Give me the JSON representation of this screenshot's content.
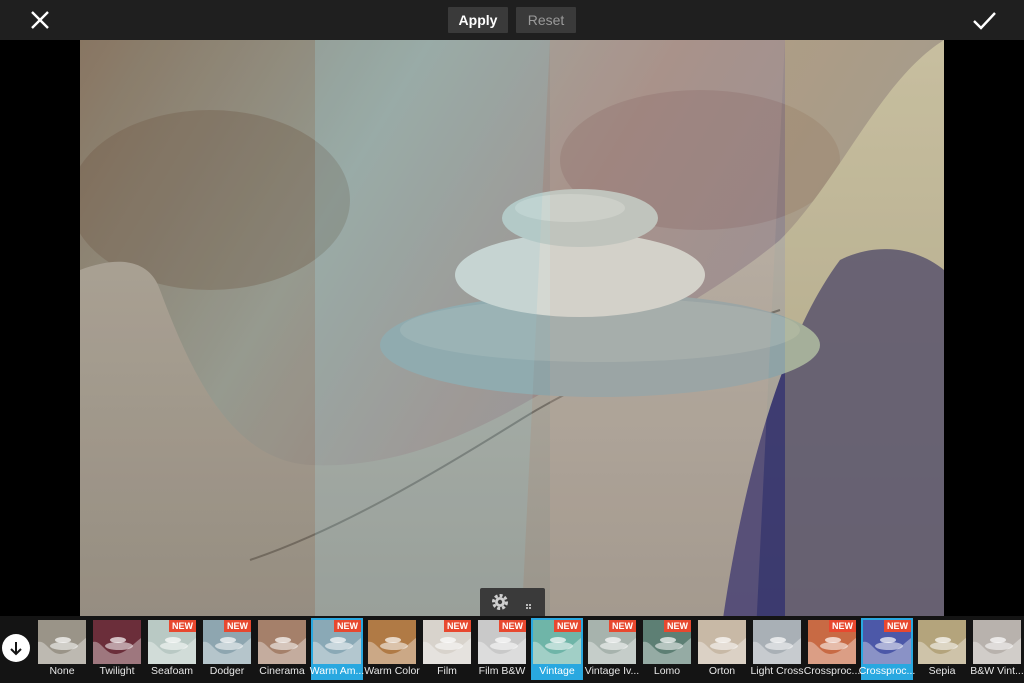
{
  "toolbar": {
    "apply_label": "Apply",
    "reset_label": "Reset",
    "close_icon": "close-icon",
    "confirm_icon": "checkmark-icon"
  },
  "settings": {
    "icon": "gear-icon"
  },
  "filmstrip": {
    "collapse_icon": "arrow-down-icon",
    "new_badge": "NEW",
    "filters": [
      {
        "label": "None",
        "new": false,
        "selected": false,
        "tint": "#9a9488"
      },
      {
        "label": "Twilight",
        "new": false,
        "selected": false,
        "tint": "#6b2e3a"
      },
      {
        "label": "Seafoam",
        "new": true,
        "selected": false,
        "tint": "#b9c9c4"
      },
      {
        "label": "Dodger",
        "new": true,
        "selected": false,
        "tint": "#8ea6b0"
      },
      {
        "label": "Cinerama",
        "new": false,
        "selected": false,
        "tint": "#a5806a"
      },
      {
        "label": "Warm Am...",
        "new": true,
        "selected": true,
        "tint": "#8aa9b6"
      },
      {
        "label": "Warm Color",
        "new": false,
        "selected": false,
        "tint": "#b07a45"
      },
      {
        "label": "Film",
        "new": true,
        "selected": false,
        "tint": "#d8d3cc"
      },
      {
        "label": "Film B&W",
        "new": true,
        "selected": false,
        "tint": "#c9c9c9"
      },
      {
        "label": "Vintage",
        "new": true,
        "selected": true,
        "tint": "#6fb5a8"
      },
      {
        "label": "Vintage Iv...",
        "new": true,
        "selected": false,
        "tint": "#a7b3ad"
      },
      {
        "label": "Lomo",
        "new": true,
        "selected": false,
        "tint": "#5d7f74"
      },
      {
        "label": "Orton",
        "new": false,
        "selected": false,
        "tint": "#c8b9a6"
      },
      {
        "label": "Light Cross",
        "new": false,
        "selected": false,
        "tint": "#a9b0b6"
      },
      {
        "label": "Crossproc...",
        "new": true,
        "selected": false,
        "tint": "#c86a44"
      },
      {
        "label": "Crossproc...",
        "new": true,
        "selected": true,
        "tint": "#4c58a8"
      },
      {
        "label": "Sepia",
        "new": false,
        "selected": false,
        "tint": "#b4a47c"
      },
      {
        "label": "B&W Vint...",
        "new": false,
        "selected": false,
        "tint": "#b8b2ad"
      }
    ]
  }
}
